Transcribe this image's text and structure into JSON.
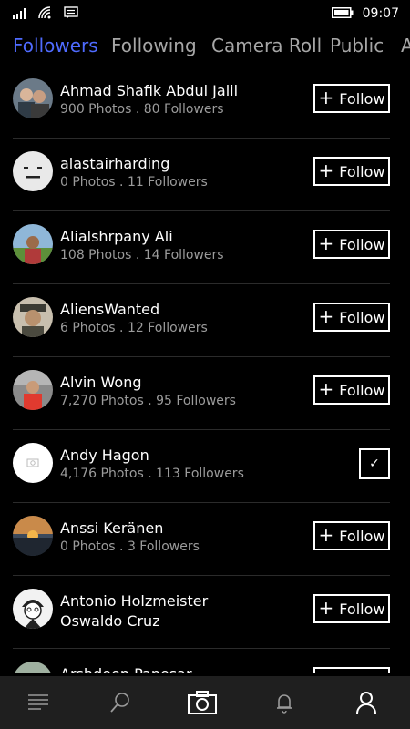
{
  "status_bar": {
    "time": "09:07",
    "icons": [
      "signal-icon",
      "wifi-icon",
      "message-icon",
      "battery-icon"
    ]
  },
  "tabs": [
    {
      "label": "Followers",
      "active": true
    },
    {
      "label": "Following",
      "active": false
    },
    {
      "label": "Camera Roll",
      "active": false
    },
    {
      "label": "Public",
      "active": false
    },
    {
      "label": "A",
      "active": false
    }
  ],
  "list": [
    {
      "name": "Ahmad Shafik Abdul Jalil",
      "sub": "900 Photos . 80 Followers",
      "action": "follow",
      "avatar": "two-people"
    },
    {
      "name": "alastairharding",
      "sub": "0 Photos . 11 Followers",
      "action": "follow",
      "avatar": "placeholder-face"
    },
    {
      "name": "Alialshrpany Ali",
      "sub": "108 Photos . 14 Followers",
      "action": "follow",
      "avatar": "outdoor-person"
    },
    {
      "name": "AliensWanted",
      "sub": "6 Photos . 12 Followers",
      "action": "follow",
      "avatar": "old-man"
    },
    {
      "name": "Alvin Wong",
      "sub": "7,270 Photos . 95 Followers",
      "action": "follow",
      "avatar": "red-shirt"
    },
    {
      "name": "Andy Hagon",
      "sub": "4,176 Photos . 113 Followers",
      "action": "following",
      "avatar": "white-camera"
    },
    {
      "name": "Anssi Keränen",
      "sub": "0 Photos . 3 Followers",
      "action": "follow",
      "avatar": "sunset"
    },
    {
      "name": "Antonio Holzmeister",
      "sub": "Oswaldo Cruz",
      "action": "follow",
      "avatar": "sketch-face"
    },
    {
      "name": "Arshdeep Panesar",
      "sub": "",
      "action": "follow",
      "avatar": "person-partial"
    }
  ],
  "labels": {
    "follow": "Follow",
    "plus": "+",
    "check": "✓"
  },
  "appbar": {
    "buttons": [
      "feed-icon",
      "search-icon",
      "camera-icon",
      "notifications-icon",
      "profile-icon"
    ]
  },
  "colors": {
    "accent": "#4f6bff",
    "background": "#000000",
    "appbar": "#1f1f1f",
    "secondary_text": "#9b9b9b"
  }
}
